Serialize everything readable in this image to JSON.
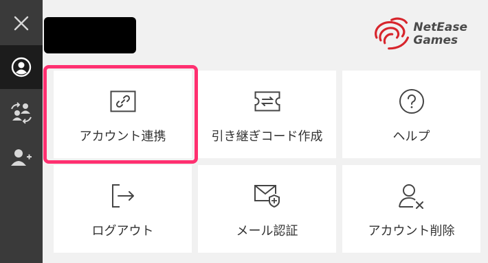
{
  "sidebar": {
    "items": [
      {
        "icon": "close-icon"
      },
      {
        "icon": "user-profile-icon",
        "active": true
      },
      {
        "icon": "account-switch-icon"
      },
      {
        "icon": "add-user-icon"
      }
    ]
  },
  "header": {
    "logo": {
      "line1": "NetEase",
      "line2": "Games",
      "brand_color": "#d7252c"
    }
  },
  "menu": {
    "items": [
      {
        "label": "アカウント連携",
        "icon": "link-icon",
        "highlighted": true
      },
      {
        "label": "引き継ぎコード作成",
        "icon": "transfer-code-icon"
      },
      {
        "label": "ヘルプ",
        "icon": "help-icon"
      },
      {
        "label": "ログアウト",
        "icon": "logout-icon"
      },
      {
        "label": "メール認証",
        "icon": "mail-verify-icon"
      },
      {
        "label": "アカウント削除",
        "icon": "delete-account-icon"
      }
    ]
  },
  "colors": {
    "sidebar_bg": "#3a3a3a",
    "sidebar_active": "#1c1c1c",
    "highlight": "#ff3070",
    "page_bg": "#f1f1f1",
    "card_bg": "#ffffff"
  }
}
